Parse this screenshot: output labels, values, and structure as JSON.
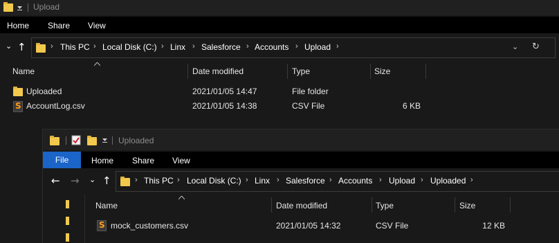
{
  "window1": {
    "title": "Upload",
    "ribbon_tabs": [
      "Home",
      "Share",
      "View"
    ],
    "breadcrumb": [
      "This PC",
      "Local Disk (C:)",
      "Linx",
      "Salesforce",
      "Accounts",
      "Upload"
    ],
    "columns": [
      "Name",
      "Date modified",
      "Type",
      "Size"
    ],
    "rows": [
      {
        "name": "Uploaded",
        "date": "2021/01/05 14:47",
        "type": "File folder",
        "size": "",
        "icon": "folder-icon"
      },
      {
        "name": "AccountLog.csv",
        "date": "2021/01/05 14:38",
        "type": "CSV File",
        "size": "6 KB",
        "icon": "csv-file-icon"
      }
    ]
  },
  "window2": {
    "title": "Uploaded",
    "file_tab": "File",
    "ribbon_tabs": [
      "Home",
      "Share",
      "View"
    ],
    "breadcrumb": [
      "This PC",
      "Local Disk (C:)",
      "Linx",
      "Salesforce",
      "Accounts",
      "Upload",
      "Uploaded"
    ],
    "columns": [
      "Name",
      "Date modified",
      "Type",
      "Size"
    ],
    "rows": [
      {
        "name": "mock_customers.csv",
        "date": "2021/01/05 14:32",
        "type": "CSV File",
        "size": "12 KB",
        "icon": "csv-file-icon"
      }
    ]
  },
  "colors": {
    "background": "#191919",
    "file_tab": "#1b64c8",
    "folder": "#f2c94c",
    "csv_accent": "#ff9a1a"
  }
}
